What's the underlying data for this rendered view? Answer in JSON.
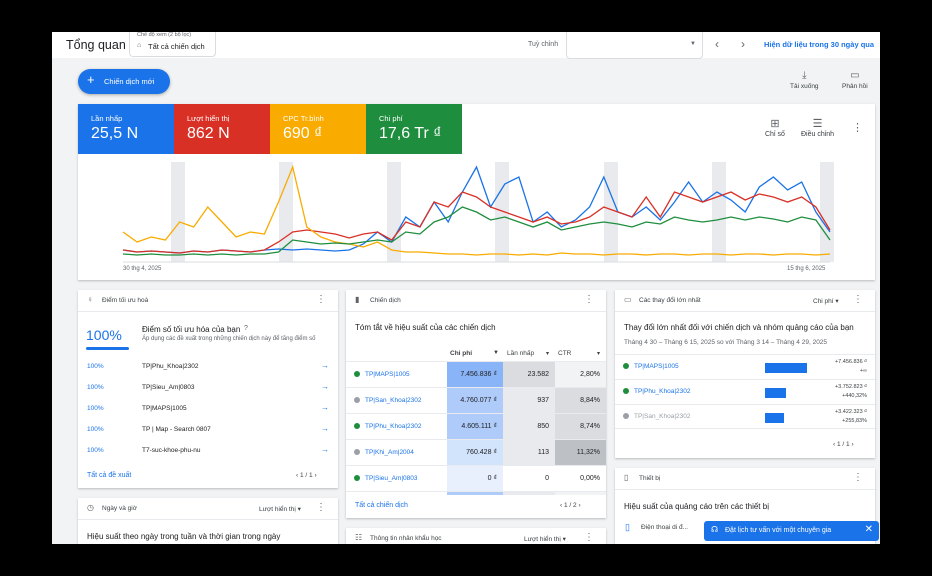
{
  "header": {
    "title": "Tổng quan",
    "view_mode_label": "Chế độ xem (2 bộ lọc)",
    "view_mode_value": "Tất cả chiến dịch",
    "custom_label": "Tuỳ chỉnh",
    "date_range_value": "",
    "range_link": "Hiện dữ liệu trong 30 ngày qua"
  },
  "toolbar": {
    "new_campaign_label": "Chiến dịch mới",
    "download_label": "Tải xuống",
    "feedback_label": "Phản hồi"
  },
  "overview": {
    "metrics": [
      {
        "label": "Lần nhấp",
        "value": "25,5 N",
        "color": "#1a73e8"
      },
      {
        "label": "Lượt hiển thị",
        "value": "862 N",
        "color": "#d93025"
      },
      {
        "label": "CPC Tr.bình",
        "value": "690 ₫",
        "color": "#f9ab00"
      },
      {
        "label": "Chi phí",
        "value": "17,6 Tr ₫",
        "color": "#1e8e3e"
      }
    ],
    "tools": {
      "metrics_label": "Chỉ số",
      "adjust_label": "Điều chỉnh"
    },
    "date_start": "30 thg 4, 2025",
    "date_end": "15 thg 6, 2025"
  },
  "chart_data": {
    "type": "line",
    "x": [
      "30 thg 4, 2025",
      "15 thg 6, 2025"
    ],
    "series": [
      {
        "name": "Lần nhấp",
        "color": "#1a73e8",
        "values": [
          0.12,
          0.1,
          0.11,
          0.1,
          0.09,
          0.11,
          0.1,
          0.12,
          0.11,
          0.1,
          0.12,
          0.13,
          0.12,
          0.13,
          0.12,
          0.11,
          0.12,
          0.18,
          0.3,
          0.2,
          0.45,
          0.35,
          0.6,
          0.4,
          0.7,
          0.95,
          0.55,
          0.78,
          0.85,
          0.4,
          0.5,
          0.35,
          0.42,
          0.55,
          0.85,
          0.5,
          0.45,
          0.55,
          0.42,
          0.6,
          0.8,
          0.6,
          0.7,
          0.62,
          0.5,
          0.75,
          0.85,
          0.72,
          0.8,
          0.5,
          0.3
        ]
      },
      {
        "name": "Lượt hiển thị",
        "color": "#d93025",
        "values": [
          0.12,
          0.1,
          0.11,
          0.1,
          0.09,
          0.11,
          0.1,
          0.12,
          0.11,
          0.1,
          0.12,
          0.2,
          0.3,
          0.32,
          0.3,
          0.28,
          0.24,
          0.28,
          0.3,
          0.22,
          0.4,
          0.35,
          0.6,
          0.55,
          0.7,
          0.65,
          0.55,
          0.5,
          0.45,
          0.4,
          0.45,
          0.38,
          0.4,
          0.45,
          0.55,
          0.5,
          0.45,
          0.65,
          0.45,
          0.7,
          0.65,
          0.6,
          0.65,
          0.7,
          0.62,
          0.68,
          0.65,
          0.6,
          0.65,
          0.55,
          0.32
        ]
      },
      {
        "name": "CPC Tr.bình",
        "color": "#f9ab00",
        "values": [
          0.3,
          0.2,
          0.25,
          0.22,
          0.4,
          0.35,
          0.55,
          0.4,
          0.25,
          0.3,
          0.28,
          0.6,
          0.95,
          0.35,
          0.25,
          0.2,
          0.18,
          0.15,
          0.2,
          0.12,
          0.1,
          0.1,
          0.09,
          0.08,
          0.08,
          0.07,
          0.08,
          0.08,
          0.07,
          0.08,
          0.07,
          0.09,
          0.08,
          0.08,
          0.07,
          0.08,
          0.08,
          0.07,
          0.08,
          0.08,
          0.07,
          0.08,
          0.08,
          0.07,
          0.08,
          0.08,
          0.07,
          0.08,
          0.08,
          0.07,
          0.08
        ]
      },
      {
        "name": "Chi phí",
        "color": "#1e8e3e",
        "values": [
          0.08,
          0.07,
          0.08,
          0.07,
          0.07,
          0.08,
          0.07,
          0.08,
          0.07,
          0.08,
          0.08,
          0.1,
          0.22,
          0.2,
          0.18,
          0.19,
          0.18,
          0.2,
          0.22,
          0.2,
          0.3,
          0.28,
          0.4,
          0.45,
          0.55,
          0.5,
          0.42,
          0.45,
          0.4,
          0.35,
          0.4,
          0.32,
          0.35,
          0.38,
          0.4,
          0.38,
          0.35,
          0.4,
          0.38,
          0.45,
          0.42,
          0.4,
          0.42,
          0.45,
          0.42,
          0.45,
          0.43,
          0.4,
          0.45,
          0.42,
          0.22
        ]
      }
    ],
    "ylim": [
      0,
      1
    ],
    "grid": false,
    "legend": "top"
  },
  "optimization": {
    "header": "Điểm tối ưu hoá",
    "score": "100%",
    "title": "Điểm số tối ưu hóa của bạn",
    "desc": "Áp dụng các đề xuất trong những chiến dịch này để tăng điểm số",
    "items": [
      {
        "pct": "100%",
        "name": "TP|Phu_Khoa|2302"
      },
      {
        "pct": "100%",
        "name": "TP|Sieu_Am|0803"
      },
      {
        "pct": "100%",
        "name": "TP|MAPS|1005"
      },
      {
        "pct": "100%",
        "name": "TP | Map - Search 0807"
      },
      {
        "pct": "100%",
        "name": "T7-suc-khoe-phu-nu"
      }
    ],
    "all_link": "Tất cả đề xuất",
    "pager": "1 / 1"
  },
  "campaigns": {
    "header": "Chiến dịch",
    "title": "Tóm tắt về hiệu suất của các chiến dịch",
    "columns": [
      "Chi phí",
      "Lần nhấp",
      "CTR"
    ],
    "rows": [
      {
        "name": "TP|MAPS|1005",
        "dot": "#1e8e3e",
        "cost": "7.456.836 ₫",
        "clicks": "23.582",
        "ctr": "2,80%"
      },
      {
        "name": "TP|San_Khoa|2302",
        "dot": "#9aa0a6",
        "cost": "4.760.077 ₫",
        "clicks": "937",
        "ctr": "8,84%"
      },
      {
        "name": "TP|Phu_Khoa|2302",
        "dot": "#1e8e3e",
        "cost": "4.605.111 ₫",
        "clicks": "850",
        "ctr": "8,74%"
      },
      {
        "name": "TP|Khi_Am|2004",
        "dot": "#9aa0a6",
        "cost": "760.428 ₫",
        "clicks": "113",
        "ctr": "11,32%"
      },
      {
        "name": "TP|Sieu_Am|0803",
        "dot": "#1e8e3e",
        "cost": "0 ₫",
        "clicks": "0",
        "ctr": "0,00%"
      }
    ],
    "all_link": "Tất cả chiến dịch",
    "pager": "1 / 2"
  },
  "changes": {
    "header": "Các thay đổi lớn nhất",
    "dropdown": "Chi phí",
    "title": "Thay đổi lớn nhất đối với chiến dịch và nhóm quảng cáo của bạn",
    "subtitle": "Tháng 4 30 – Tháng 6 15, 2025 so với Tháng 3 14 – Tháng 4 29, 2025",
    "rows": [
      {
        "name": "TP|MAPS|1005",
        "dot": "#1e8e3e",
        "v1": "+7.456.836 ₫",
        "v2": "+∞",
        "bar": 1.0
      },
      {
        "name": "TP|Phu_Khoa|2302",
        "dot": "#1e8e3e",
        "v1": "+3.752.823 ₫",
        "v2": "+440,32%",
        "bar": 0.5
      },
      {
        "name": "TP|San_Khoa|2302",
        "dot": "#9aa0a6",
        "v1": "+3.422.323 ₫",
        "v2": "+255,83%",
        "bar": 0.46
      }
    ],
    "pager": "1 / 1"
  },
  "devices": {
    "header": "Thiết bị",
    "title": "Hiệu suất của quảng cáo trên các thiết bị",
    "first_device": "Điện thoại di đ..."
  },
  "daytime": {
    "header": "Ngày và giờ",
    "dropdown": "Lượt hiển thị",
    "title": "Hiệu suất theo ngày trong tuần và thời gian trong ngày"
  },
  "audience": {
    "header": "Thông tin nhân khẩu học",
    "dropdown": "Lượt hiển thị"
  },
  "snackbar": {
    "text": "Đặt lịch tư vấn với một chuyên gia"
  }
}
